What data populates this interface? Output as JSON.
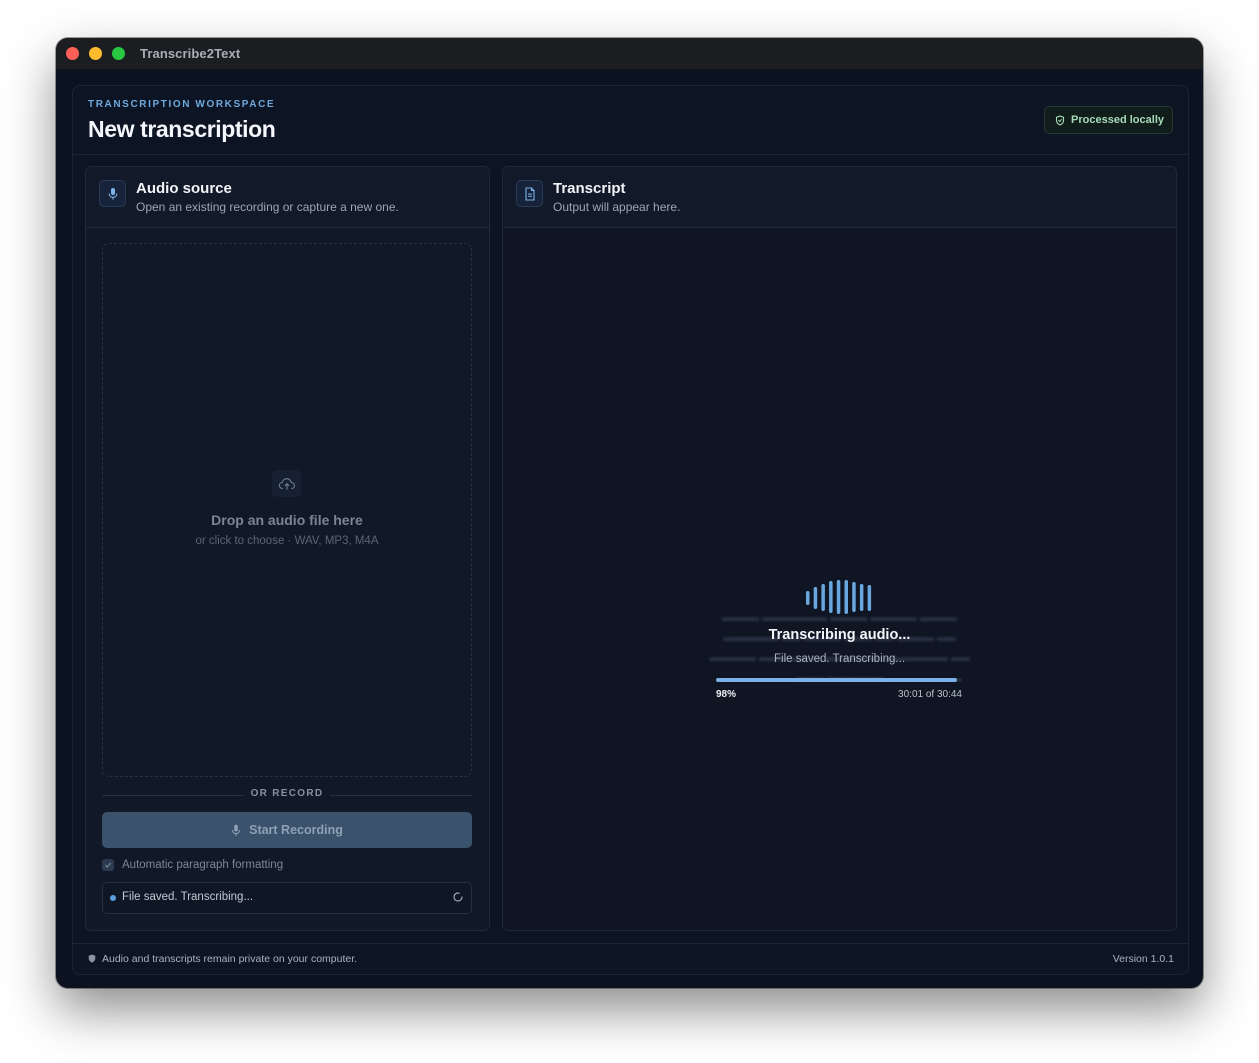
{
  "window": {
    "title": "Transcribe2Text"
  },
  "header": {
    "eyebrow": "TRANSCRIPTION WORKSPACE",
    "title": "New transcription",
    "badge": "Processed locally",
    "badge_icon": "shield-check-icon"
  },
  "audio_source": {
    "title": "Audio source",
    "subtitle": "Open an existing recording or capture a new one.",
    "icon": "microphone-icon",
    "dropzone": {
      "icon": "cloud-upload-icon",
      "title": "Drop an audio file here",
      "subtitle": "or click to choose · WAV, MP3, M4A"
    },
    "divider": "OR RECORD",
    "record_button": "Start Recording",
    "auto_format": {
      "label": "Automatic paragraph formatting",
      "checked": true
    },
    "status": "File saved. Transcribing..."
  },
  "transcript": {
    "title": "Transcript",
    "subtitle": "Output will appear here.",
    "icon": "document-icon",
    "progress": {
      "title": "Transcribing audio...",
      "status": "File saved. Transcribing...",
      "percent": 98,
      "percent_label": "98%",
      "time": "30:01 of 30:44"
    }
  },
  "footer": {
    "privacy": "Audio and transcripts remain private on your computer.",
    "version": "Version 1.0.1"
  },
  "colors": {
    "accent": "#6fa8dc",
    "progress": "#7bb1e6",
    "local": "#a7dcb9"
  }
}
